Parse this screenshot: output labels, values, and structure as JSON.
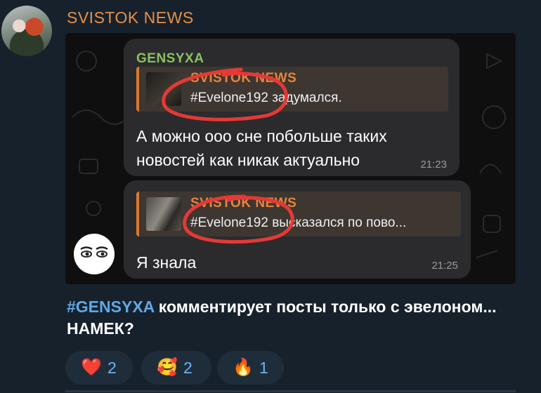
{
  "channel": {
    "name": "SVISTOK NEWS"
  },
  "screenshot": {
    "messages": [
      {
        "sender": "GENSYXA",
        "reply_title": "SVISTOK NEWS",
        "reply_text": "#Evelone192 задумался.",
        "text": "А можно ооо сне побольше таких новостей как никак актуально",
        "time": "21:23"
      },
      {
        "reply_title": "SVISTOK NEWS",
        "reply_text": "#Evelone192 высказался по пово...",
        "text": "Я знала",
        "time": "21:25"
      }
    ]
  },
  "caption": {
    "hashtag": "#GENSYXA",
    "text": " комментирует посты только с эвелоном... НАМЕК?"
  },
  "reactions": [
    {
      "icon": "heart-icon",
      "emoji": "❤️",
      "count": "2"
    },
    {
      "icon": "smiling-face-with-hearts-icon",
      "emoji": "🥰",
      "count": "2"
    },
    {
      "icon": "fire-icon",
      "emoji": "🔥",
      "count": "1"
    }
  ],
  "colors": {
    "channel_name": "#e7904b",
    "sender": "#89c25e",
    "reply_accent": "#d97a2b",
    "hashtag": "#5fa8ea",
    "scribble": "#e53935"
  }
}
